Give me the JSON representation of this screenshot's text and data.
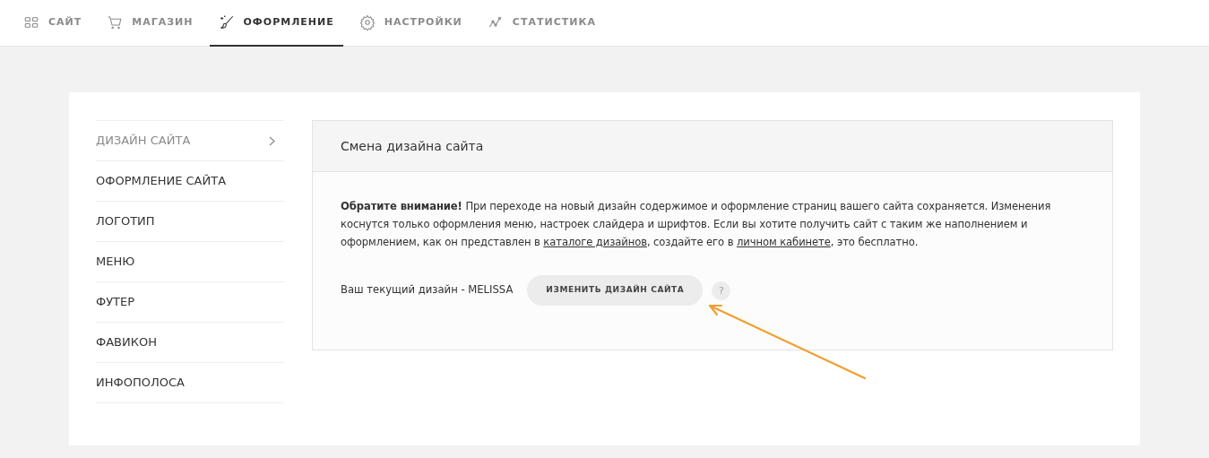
{
  "tabs": [
    {
      "label": "САЙТ",
      "kind": "grid",
      "selected": false
    },
    {
      "label": "МАГАЗИН",
      "kind": "cart",
      "selected": false
    },
    {
      "label": "ОФОРМЛЕНИЕ",
      "kind": "brush",
      "selected": true
    },
    {
      "label": "НАСТРОЙКИ",
      "kind": "gear",
      "selected": false
    },
    {
      "label": "СТАТИСТИКА",
      "kind": "chart",
      "selected": false
    }
  ],
  "sidebar": {
    "items": [
      {
        "label": "ДИЗАЙН САЙТА",
        "selected": true
      },
      {
        "label": "ОФОРМЛЕНИЕ САЙТА",
        "selected": false
      },
      {
        "label": "ЛОГОТИП",
        "selected": false
      },
      {
        "label": "МЕНЮ",
        "selected": false
      },
      {
        "label": "ФУТЕР",
        "selected": false
      },
      {
        "label": "ФАВИКОН",
        "selected": false
      },
      {
        "label": "ИНФОПОЛОСА",
        "selected": false
      }
    ]
  },
  "panel": {
    "title": "Смена дизайна сайта",
    "notice": [
      {
        "kind": "text",
        "text": "**Обратите внимание!** При переходе на новый дизайн содержимое и оформление страниц вашего сайта сохраняется. Изменения коснутся только оформления меню, настроек слайдера и шрифтов. Если вы хотите получить сайт с таким же наполнением и оформлением, как он представлен в "
      },
      {
        "kind": "link",
        "text": "каталоге дизайнов"
      },
      {
        "kind": "text",
        "text": ", создайте его в "
      },
      {
        "kind": "link",
        "text": "личном кабинете"
      },
      {
        "kind": "text",
        "text": ", это бесплатно."
      }
    ],
    "current_design": "Ваш текущий дизайн - MELISSA",
    "button": "ИЗМЕНИТЬ ДИЗАЙН САЙТА",
    "help": "?"
  }
}
